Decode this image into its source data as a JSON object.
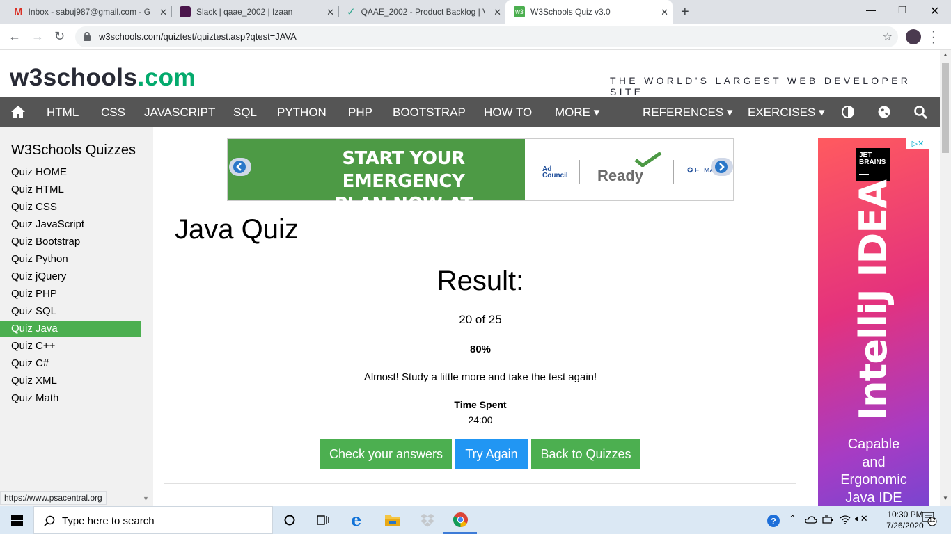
{
  "browser": {
    "tabs": [
      {
        "title": "Inbox - sabuj987@gmail.com - G",
        "icon": "gmail-icon"
      },
      {
        "title": "Slack | qaae_2002 | Izaan",
        "icon": "slack-icon"
      },
      {
        "title": "QAAE_2002 - Product Backlog | V",
        "icon": "checkmark-icon"
      },
      {
        "title": "W3Schools Quiz v3.0",
        "icon": "w3schools-icon",
        "active": true
      }
    ],
    "url": "w3schools.com/quiztest/quiztest.asp?qtest=JAVA",
    "status_url": "https://www.psacentral.org"
  },
  "site": {
    "logo_main": "w3schools",
    "logo_suffix": ".com",
    "tagline": "THE WORLD'S LARGEST WEB DEVELOPER SITE",
    "brand_green": "#4caf50",
    "nav_bg": "#555555",
    "nav": [
      "HTML",
      "CSS",
      "JAVASCRIPT",
      "SQL",
      "PYTHON",
      "PHP",
      "BOOTSTRAP",
      "HOW TO",
      "MORE ▾",
      "REFERENCES ▾",
      "EXERCISES ▾"
    ]
  },
  "sidebar": {
    "title": "W3Schools Quizzes",
    "items": [
      "Quiz HOME",
      "Quiz HTML",
      "Quiz CSS",
      "Quiz JavaScript",
      "Quiz Bootstrap",
      "Quiz Python",
      "Quiz jQuery",
      "Quiz PHP",
      "Quiz SQL",
      "Quiz Java",
      "Quiz C++",
      "Quiz C#",
      "Quiz XML",
      "Quiz Math"
    ],
    "active_index": 9
  },
  "ad_top": {
    "headline_1": "START YOUR EMERGENCY",
    "headline_2": "PLAN NOW AT READY.GOV",
    "council": "Ad Council",
    "ready": "Ready",
    "fema": "FEMA"
  },
  "quiz": {
    "title": "Java Quiz",
    "result_label": "Result:",
    "score": "20 of 25",
    "percent": "80%",
    "message": "Almost! Study a little more and take the test again!",
    "time_label": "Time Spent",
    "time_value": "24:00",
    "buttons": {
      "check": "Check your answers",
      "again": "Try Again",
      "back": "Back to Quizzes"
    }
  },
  "ad_side": {
    "brand_line1": "JET",
    "brand_line2": "BRAINS",
    "product": "IntelliJ IDEA",
    "tagline_1": "Capable",
    "tagline_2": "and",
    "tagline_3": "Ergonomic",
    "tagline_4": "Java IDE",
    "adchoices": "▷✕"
  },
  "taskbar": {
    "search_placeholder": "Type here to search",
    "time": "10:30 PM",
    "date": "7/26/2020",
    "notifications": "12"
  }
}
